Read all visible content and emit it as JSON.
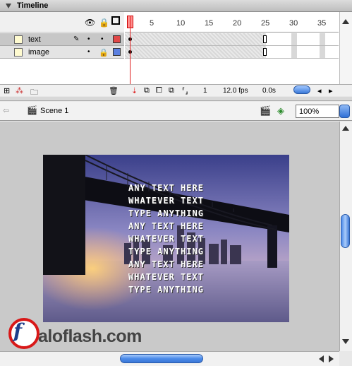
{
  "timeline": {
    "title": "Timeline",
    "ruler_numbers": [
      "1",
      "5",
      "10",
      "15",
      "20",
      "25",
      "30",
      "35"
    ],
    "layers": [
      {
        "name": "text",
        "outline_color": "#e04848",
        "pencil": "✎"
      },
      {
        "name": "image",
        "outline_color": "#5a7fe0"
      }
    ],
    "status": {
      "current_frame": "1",
      "frame_rate": "12.0 fps",
      "elapsed_time": "0.0s"
    }
  },
  "editbar": {
    "scene_label": "Scene 1",
    "zoom_value": "100%"
  },
  "stage": {
    "text_lines": [
      "ANY TEXT HERE",
      "WHATEVER TEXT",
      "TYPE ANYTHING",
      "ANY TEXT HERE",
      "WHATEVER TEXT",
      "TYPE ANYTHING",
      "ANY TEXT HERE",
      "WHATEVER TEXT",
      "TYPE ANYTHING"
    ]
  },
  "watermark": {
    "logo_letter": "f",
    "text": "aloflash.com"
  },
  "colors": {
    "accent_blue": "#3b77d6",
    "playhead_red": "#e02020",
    "stage_bg": "#c9c9c9"
  }
}
